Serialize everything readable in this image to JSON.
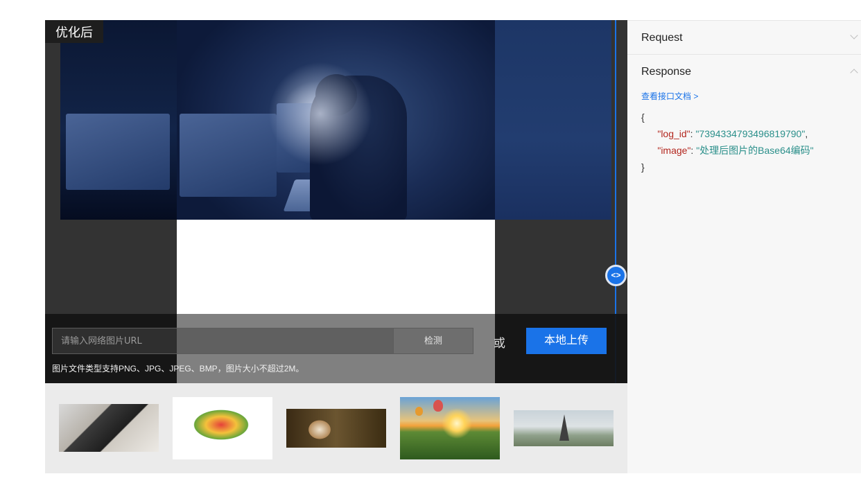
{
  "demo": {
    "result_label": "优化后",
    "divider_handle_glyph": "<>",
    "url_placeholder": "请输入网络图片URL",
    "detect_label": "检测",
    "or_text": "或",
    "upload_label": "本地上传",
    "hint": "图片文件类型支持PNG、JPG、JPEG、BMP，图片大小不超过2M。",
    "thumbnails": [
      "driver-woman",
      "fruit-bowl",
      "kitten",
      "hot-air-balloons-sunset",
      "paris-eiffel-tower"
    ]
  },
  "api": {
    "request_label": "Request",
    "response_label": "Response",
    "doc_link": "查看接口文档 >",
    "json": {
      "open": "{",
      "log_id_key": "\"log_id\"",
      "log_id_value": "\"7394334793496819790\"",
      "image_key": "\"image\"",
      "image_value": "\"处理后图片的Base64编码\"",
      "close": "}"
    }
  },
  "colors": {
    "accent": "#1a73e8",
    "json_key": "#b3261e",
    "json_string": "#2a8f8a"
  }
}
